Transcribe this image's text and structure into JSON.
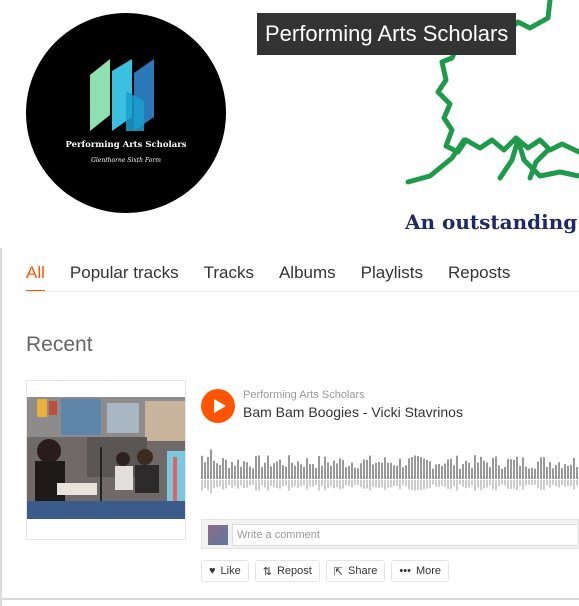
{
  "profile": {
    "name": "Performing Arts Scholars",
    "avatar_text": "Performing Arts Scholars",
    "avatar_subtext": "Glenthorne Sixth Form"
  },
  "banner": {
    "tagline": "An outstanding l"
  },
  "tabs": [
    {
      "label": "All",
      "active": true
    },
    {
      "label": "Popular tracks"
    },
    {
      "label": "Tracks"
    },
    {
      "label": "Albums"
    },
    {
      "label": "Playlists"
    },
    {
      "label": "Reposts"
    }
  ],
  "recent": {
    "heading": "Recent",
    "track": {
      "user": "Performing Arts Scholars",
      "title": "Bam Bam Boogies - Vicki Stavrinos",
      "comment_placeholder": "Write a comment",
      "actions": {
        "like": "Like",
        "repost": "Repost",
        "share": "Share",
        "more": "More"
      }
    }
  },
  "colors": {
    "accent": "#ff5500",
    "banner_green": "#1e9a4a",
    "tagline_navy": "#1d2a63"
  },
  "icons": [
    "play-icon",
    "heart-icon",
    "repost-icon",
    "share-icon",
    "more-icon"
  ]
}
